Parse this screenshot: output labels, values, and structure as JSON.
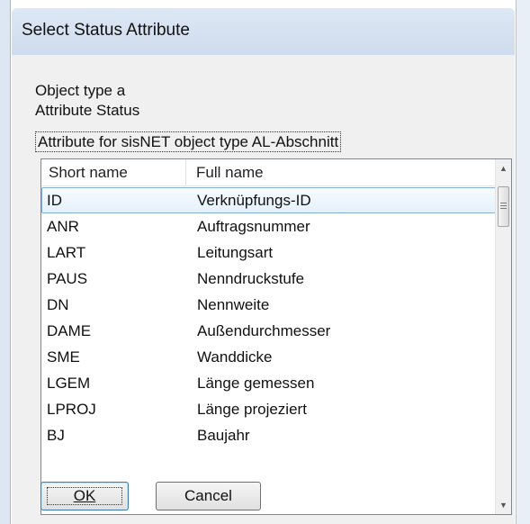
{
  "dialog": {
    "title": "Select Status Attribute",
    "object_type_line": "Object type a",
    "attribute_line": "Attribute Status",
    "group_label": "Attribute for sisNET object type AL-Abschnitt"
  },
  "list": {
    "columns": [
      "Short name",
      "Full name"
    ],
    "rows": [
      {
        "short": "ID",
        "full": "Verknüpfungs-ID",
        "selected": true
      },
      {
        "short": "ANR",
        "full": "Auftragsnummer"
      },
      {
        "short": "LART",
        "full": "Leitungsart"
      },
      {
        "short": "PAUS",
        "full": "Nenndruckstufe"
      },
      {
        "short": "DN",
        "full": "Nennweite"
      },
      {
        "short": "DAME",
        "full": "Außendurchmesser"
      },
      {
        "short": "SME",
        "full": "Wanddicke"
      },
      {
        "short": "LGEM",
        "full": "Länge gemessen"
      },
      {
        "short": "LPROJ",
        "full": "Länge projeziert"
      },
      {
        "short": "BJ",
        "full": "Baujahr"
      }
    ]
  },
  "scrollbar": {
    "up_icon": "▲",
    "down_icon": "▼"
  },
  "buttons": {
    "ok": "OK",
    "cancel": "Cancel"
  }
}
